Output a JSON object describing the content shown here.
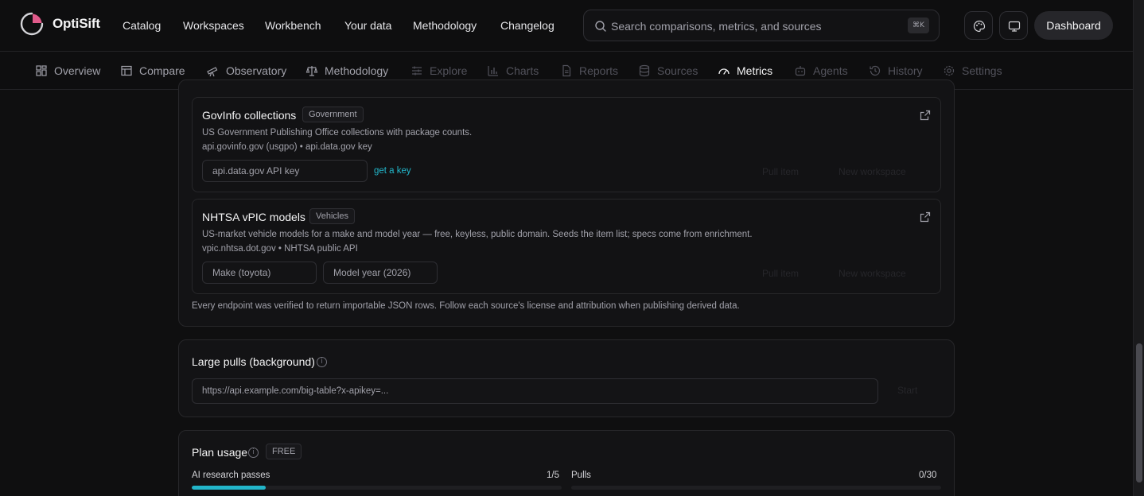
{
  "brand": {
    "name": "OptiSift",
    "accent": "#e05a8a"
  },
  "nav": [
    "Catalog",
    "Workspaces",
    "Workbench",
    "Your data",
    "Methodology",
    "Changelog"
  ],
  "search": {
    "placeholder": "Search comparisons, metrics, and sources",
    "shortcut": "⌘K"
  },
  "header_actions": {
    "palette_icon": "palette-icon",
    "display_icon": "monitor-icon",
    "dashboard_label": "Dashboard"
  },
  "tabs": [
    {
      "label": "Overview",
      "icon": "grid-icon",
      "state": "normal"
    },
    {
      "label": "Compare",
      "icon": "table-icon",
      "state": "normal"
    },
    {
      "label": "Observatory",
      "icon": "telescope-icon",
      "state": "normal"
    },
    {
      "label": "Methodology",
      "icon": "scale-icon",
      "state": "normal"
    },
    {
      "label": "Explore",
      "icon": "sliders-icon",
      "state": "disabled"
    },
    {
      "label": "Charts",
      "icon": "bar-chart-icon",
      "state": "disabled"
    },
    {
      "label": "Reports",
      "icon": "document-icon",
      "state": "disabled"
    },
    {
      "label": "Sources",
      "icon": "database-icon",
      "state": "disabled"
    },
    {
      "label": "Metrics",
      "icon": "gauge-icon",
      "state": "active"
    },
    {
      "label": "Agents",
      "icon": "bot-icon",
      "state": "disabled"
    },
    {
      "label": "History",
      "icon": "history-icon",
      "state": "disabled"
    },
    {
      "label": "Settings",
      "icon": "gear-icon",
      "state": "disabled"
    }
  ],
  "sources": [
    {
      "title": "GovInfo collections",
      "badge": "Government",
      "description": "US Government Publishing Office collections with package counts.",
      "meta": "api.govinfo.gov (usgpo) • api.data.gov key",
      "inputs": [
        "api.data.gov API key"
      ],
      "link": "get a key",
      "actions": [
        "Pull item",
        "New workspace"
      ]
    },
    {
      "title": "NHTSA vPIC models",
      "badge": "Vehicles",
      "description": "US-market vehicle models for a make and model year — free, keyless, public domain. Seeds the item list; specs come from enrichment.",
      "meta": "vpic.nhtsa.dot.gov • NHTSA public API",
      "inputs": [
        "Make (toyota)",
        "Model year (2026)"
      ],
      "actions": [
        "Pull item",
        "New workspace"
      ]
    }
  ],
  "sources_footnote": "Every endpoint was verified to return importable JSON rows. Follow each source's license and attribution when publishing derived data.",
  "large_pulls": {
    "title": "Large pulls (background)",
    "placeholder": "https://api.example.com/big-table?x-apikey=...",
    "action": "Start"
  },
  "plan_usage": {
    "title": "Plan usage",
    "plan": "FREE",
    "meters": [
      {
        "label": "AI research passes",
        "value": "1/5",
        "fraction": 0.2
      },
      {
        "label": "Pulls",
        "value": "0/30",
        "fraction": 0
      }
    ]
  },
  "colors": {
    "accent": "#22b5c9",
    "background": "#0f0f10"
  }
}
